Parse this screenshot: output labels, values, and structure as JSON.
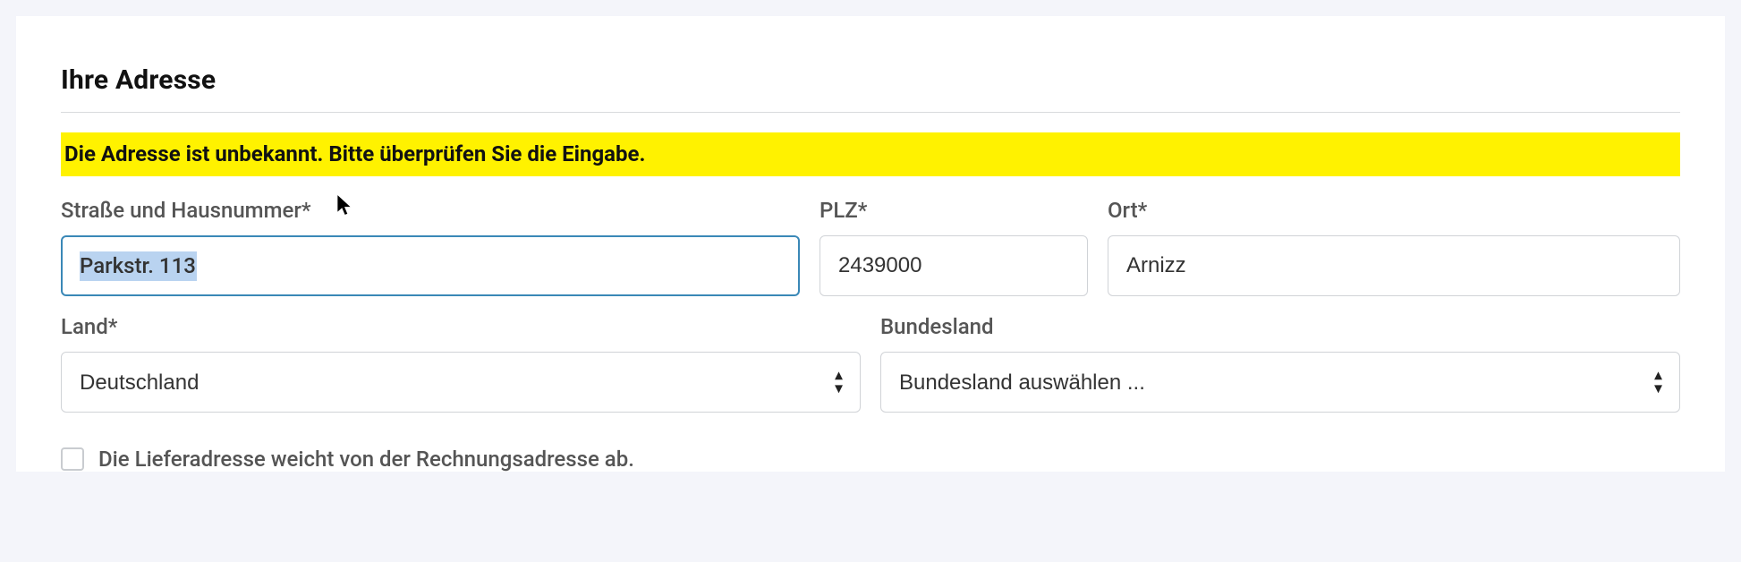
{
  "section_title": "Ihre Adresse",
  "alert": "Die Adresse ist unbekannt. Bitte überprüfen Sie die Eingabe.",
  "fields": {
    "street": {
      "label": "Straße und Hausnummer*",
      "value": "Parkstr. 113"
    },
    "plz": {
      "label": "PLZ*",
      "value": "2439000"
    },
    "ort": {
      "label": "Ort*",
      "value": "Arnizz"
    },
    "land": {
      "label": "Land*",
      "value": "Deutschland"
    },
    "state": {
      "label": "Bundesland",
      "value": "Bundesland auswählen ..."
    }
  },
  "checkbox": {
    "label": "Die Lieferadresse weicht von der Rechnungsadresse ab."
  }
}
